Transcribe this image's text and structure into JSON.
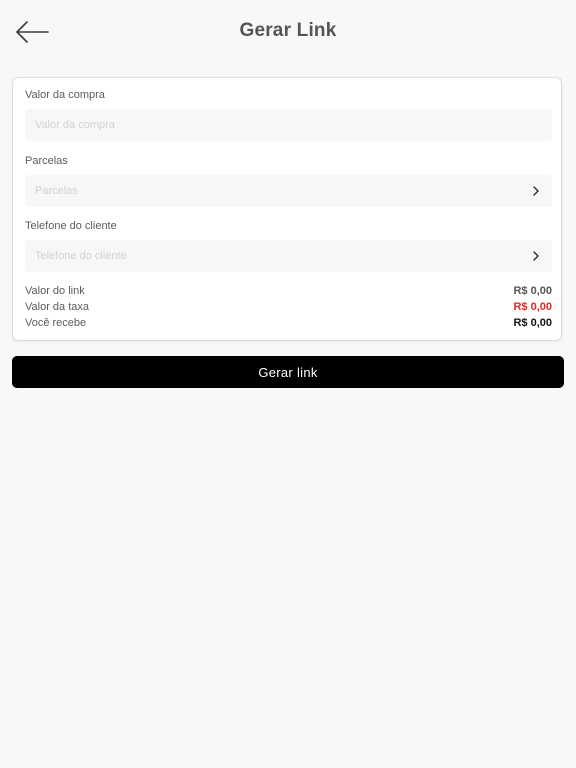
{
  "header": {
    "title": "Gerar Link",
    "back_icon": "arrow-left-icon"
  },
  "form": {
    "purchase_value": {
      "label": "Valor da compra",
      "placeholder": "Valor da compra",
      "value": ""
    },
    "installments": {
      "label": "Parcelas",
      "placeholder": "Parcelas",
      "value": "",
      "icon": "chevron-right-icon"
    },
    "customer_phone": {
      "label": "Telefone do cliente",
      "placeholder": "Telefone do cliente",
      "value": "",
      "icon": "chevron-right-icon"
    }
  },
  "summary": {
    "link_value_label": "Valor do link",
    "link_value": "R$ 0,00",
    "fee_label": "Valor da taxa",
    "fee_value": "R$ 0,00",
    "receive_label": "Você recebe",
    "receive_value": "R$ 0,00"
  },
  "actions": {
    "generate_label": "Gerar link"
  },
  "colors": {
    "background": "#f8f8f8",
    "card": "#ffffff",
    "fee_text": "#d92c2c",
    "button": "#000000"
  }
}
